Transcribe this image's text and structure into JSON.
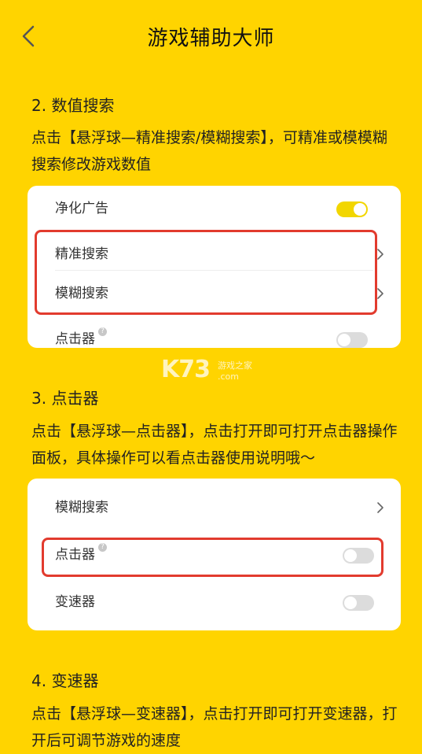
{
  "header": {
    "title": "游戏辅助大师"
  },
  "section2": {
    "title": "2. 数值搜索",
    "desc": "点击【悬浮球—精准搜索/模糊搜索】，可精准或模模糊搜索修改游戏数值",
    "rows": {
      "ad_clean": "净化广告",
      "precise_search": "精准搜索",
      "fuzzy_search": "模糊搜索",
      "clicker": "点击器"
    }
  },
  "section3": {
    "title": "3. 点击器",
    "desc": "点击【悬浮球—点击器】，点击打开即可打开点击器操作面板，具体操作可以看点击器使用说明哦～",
    "rows": {
      "fuzzy_search": "模糊搜索",
      "clicker": "点击器",
      "speeder": "变速器"
    }
  },
  "section4": {
    "title": "4. 变速器",
    "desc": "点击【悬浮球—变速器】，点击打开即可打开变速器，打开后可调节游戏的速度"
  },
  "watermark": {
    "main": "K73",
    "sub1": "游戏之家",
    "sub2": ".com"
  },
  "colors": {
    "background": "#FFD400",
    "highlight": "#E23B2E",
    "toggle_on": "#F2D600"
  },
  "toggles": {
    "section2_ad_clean_on": true,
    "section2_clicker_on": false,
    "section3_clicker_on": false,
    "section3_speeder_on": false
  }
}
